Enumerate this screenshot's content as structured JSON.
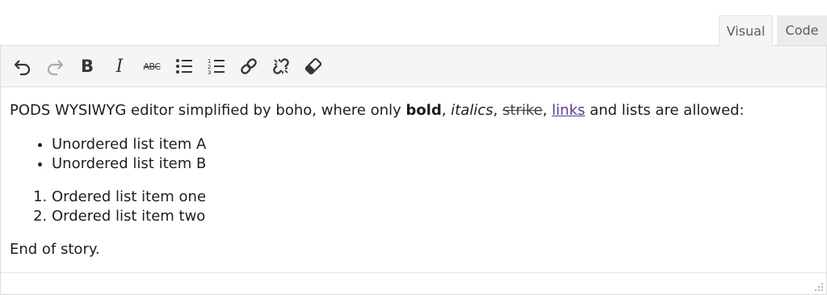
{
  "tabs": {
    "visual": "Visual",
    "code": "Code"
  },
  "toolbar": {
    "buttons": [
      "undo-icon",
      "redo-icon",
      "bold-icon",
      "italic-icon",
      "strikethrough-icon",
      "bulleted-list-icon",
      "numbered-list-icon",
      "insert-link-icon",
      "remove-link-icon",
      "clear-formatting-icon"
    ],
    "strike_glyph": "ABC",
    "bold_glyph": "B",
    "italic_glyph": "I"
  },
  "content": {
    "intro_prefix": "PODS WYSIWYG editor simplified by boho, where only ",
    "bold": "bold",
    "sep1": ", ",
    "italics": "italics",
    "sep2": ", ",
    "strike": "strike",
    "sep3": ", ",
    "link": "links",
    "intro_suffix": " and lists are allowed:",
    "unordered": [
      "Unordered list item A",
      "Unordered list item B"
    ],
    "ordered": [
      "Ordered list item one",
      "Ordered list item two"
    ],
    "closing": "End of story."
  },
  "colors": {
    "link": "#5b3c99",
    "toolbar_bg": "#f5f5f5",
    "border": "#dddddd",
    "icon": "#555d66"
  }
}
